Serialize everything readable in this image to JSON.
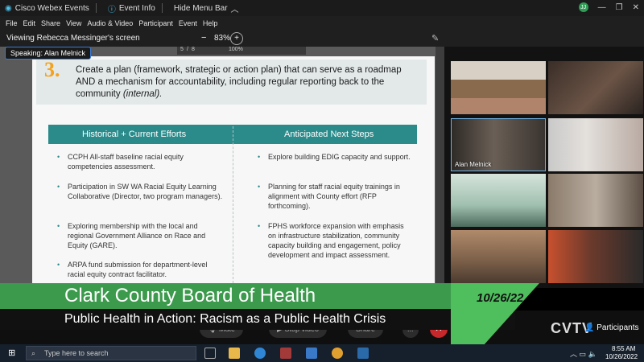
{
  "titlebar": {
    "app": "Cisco Webex Events",
    "event_info": "Event Info",
    "hide_menu": "Hide Menu Bar",
    "user_initial": "JJ"
  },
  "menu": [
    "File",
    "Edit",
    "Share",
    "View",
    "Audio & Video",
    "Participant",
    "Event",
    "Help"
  ],
  "viewbar": {
    "viewing": "Viewing Rebecca Messinger's screen",
    "zoom": "83%"
  },
  "speaking": "Speaking: Alan Melnick",
  "pdf": {
    "page": "5",
    "of": "8",
    "zoom": "100%"
  },
  "slide": {
    "number": "3.",
    "heading_main": "Create a plan (framework, strategic or action plan) that can serve as a roadmap AND a mechanism for accountability, including regular reporting back to the community",
    "heading_italic": "(internal).",
    "col_left": "Historical + Current Efforts",
    "col_right": "Anticipated Next Steps",
    "left_items": [
      "CCPH All-staff baseline racial equity competencies assessment.",
      "Participation in SW WA Racial Equity Learning Collaborative (Director, two program managers).",
      "Exploring membership with the local and regional Government Alliance on Race and Equity (GARE).",
      "ARPA fund submission for department-level racial equity contract facilitator."
    ],
    "right_items": [
      "Explore building EDIG capacity and support.",
      "Planning for staff racial equity trainings in alignment with County effort (RFP forthcoming).",
      "FPHS workforce expansion with emphasis on infrastructure stabilization, community capacity building and engagement, policy development and impact assessment."
    ]
  },
  "tiles": {
    "alan": "Alan Melnick"
  },
  "banner": {
    "title": "Clark County Board of Health",
    "subtitle": "Public Health in Action: Racism as a Public Health Crisis",
    "date": "10/26/22"
  },
  "controls": {
    "mute": "Mute",
    "stop_video": "Stop video",
    "share": "Share",
    "more": "...",
    "participants": "Participants",
    "logo": "CVTV"
  },
  "taskbar": {
    "search": "Type here to search",
    "time": "8:55 AM",
    "date": "10/26/2022"
  },
  "colors": {
    "accent_teal": "#2b8b8b",
    "banner_green": "#3c9a4c",
    "number_orange": "#f2a21e"
  }
}
